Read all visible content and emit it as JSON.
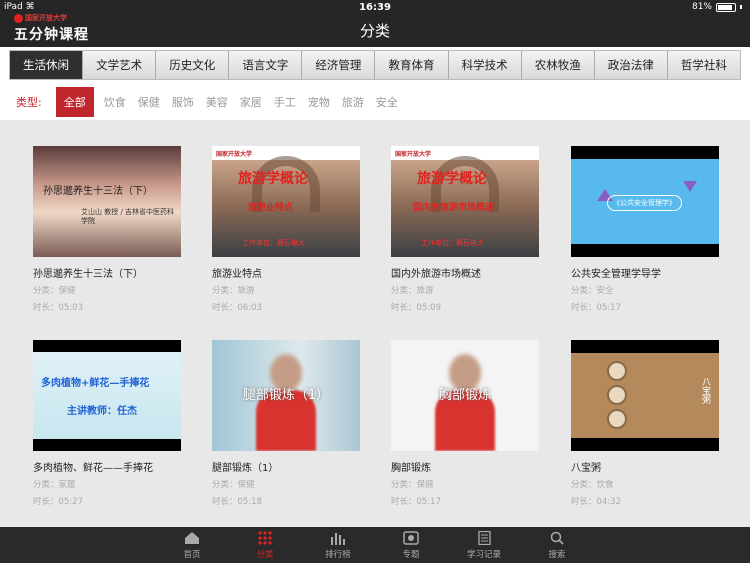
{
  "status": {
    "device": "iPad",
    "time": "16:39",
    "battery": "81%"
  },
  "logo": {
    "org": "国家开放大学",
    "name": "五分钟课程"
  },
  "title": "分类",
  "categories": [
    "生活休闲",
    "文学艺术",
    "历史文化",
    "语言文字",
    "经济管理",
    "教育体育",
    "科学技术",
    "农林牧渔",
    "政治法律",
    "哲学社科"
  ],
  "active_category": "生活休闲",
  "type_filter": {
    "label": "类型:",
    "items": [
      "全部",
      "饮食",
      "保健",
      "服饰",
      "美容",
      "家居",
      "手工",
      "宠物",
      "旅游",
      "安全"
    ]
  },
  "videos": [
    {
      "title": "孙思邈养生十三法（下）",
      "category": "分类：保健",
      "duration": "时长：05:03",
      "thumb_text": "孙思邈养生十三法（下）",
      "thumb_sub": "艾山山 教授 / 吉林省中医药科学院"
    },
    {
      "title": "旅游业特点",
      "category": "分类：旅游",
      "duration": "时长：06:03",
      "thumb_header": "国家开放大学",
      "thumb_big": "旅游学概论",
      "thumb_mid": "旅游业特点",
      "thumb_foot": "工作单位：磐石电大"
    },
    {
      "title": "国内外旅游市场概述",
      "category": "分类：旅游",
      "duration": "时长：05:09",
      "thumb_header": "国家开放大学",
      "thumb_big": "旅游学概论",
      "thumb_mid": "国内外旅游市场概述",
      "thumb_foot": "工作单位：磐石电大"
    },
    {
      "title": "公共安全管理学导学",
      "category": "分类：安全",
      "duration": "时长：05:17",
      "thumb_text": "《公共安全管理学》"
    },
    {
      "title": "多肉植物、鲜花——手捧花",
      "category": "分类：家居",
      "duration": "时长：05:27",
      "thumb_line1": "多肉植物+鲜花—手捧花",
      "thumb_line2": "主讲教师：任杰"
    },
    {
      "title": "腿部锻炼（1）",
      "category": "分类：保健",
      "duration": "时长：05:18",
      "thumb_text": "腿部锻炼（1）"
    },
    {
      "title": "胸部锻炼",
      "category": "分类：保健",
      "duration": "时长：05:17",
      "thumb_text": "胸部锻炼"
    },
    {
      "title": "八宝粥",
      "category": "分类：饮食",
      "duration": "时长：04:32",
      "thumb_text": "八宝粥"
    }
  ],
  "tabbar": [
    {
      "label": "首页",
      "icon": "home-icon"
    },
    {
      "label": "分类",
      "icon": "grid-icon",
      "active": true
    },
    {
      "label": "排行榜",
      "icon": "bar-chart-icon"
    },
    {
      "label": "专题",
      "icon": "topic-icon"
    },
    {
      "label": "学习记录",
      "icon": "notebook-icon"
    },
    {
      "label": "搜索",
      "icon": "search-icon"
    }
  ],
  "colors": {
    "accent": "#c0272d",
    "dark": "#262626"
  }
}
